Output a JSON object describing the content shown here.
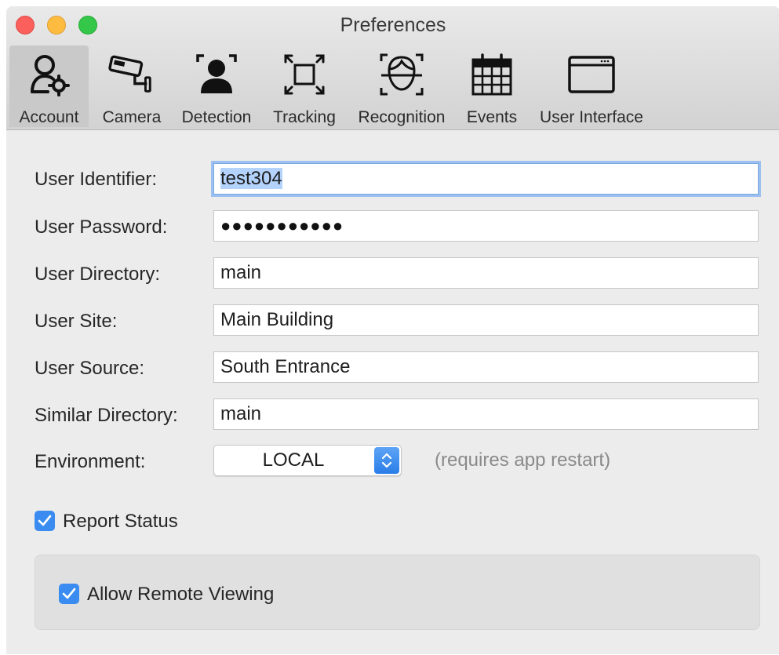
{
  "window": {
    "title": "Preferences"
  },
  "toolbar": {
    "items": [
      {
        "label": "Account",
        "icon": "account-gear-icon",
        "selected": true
      },
      {
        "label": "Camera",
        "icon": "security-camera-icon",
        "selected": false
      },
      {
        "label": "Detection",
        "icon": "person-detection-icon",
        "selected": false
      },
      {
        "label": "Tracking",
        "icon": "tracking-frame-icon",
        "selected": false
      },
      {
        "label": "Recognition",
        "icon": "face-recognition-icon",
        "selected": false
      },
      {
        "label": "Events",
        "icon": "calendar-icon",
        "selected": false
      },
      {
        "label": "User Interface",
        "icon": "window-icon",
        "selected": false
      }
    ]
  },
  "form": {
    "user_identifier": {
      "label": "User Identifier:",
      "value": "test304"
    },
    "user_password": {
      "label": "User Password:",
      "masked_value": "●●●●●●●●●●●"
    },
    "user_directory": {
      "label": "User Directory:",
      "value": "main"
    },
    "user_site": {
      "label": "User Site:",
      "value": "Main Building"
    },
    "user_source": {
      "label": "User Source:",
      "value": "South Entrance"
    },
    "similar_directory": {
      "label": "Similar Directory:",
      "value": "main"
    },
    "environment": {
      "label": "Environment:",
      "value": "LOCAL",
      "hint": "(requires app restart)"
    }
  },
  "options": {
    "report_status": {
      "label": "Report Status",
      "checked": true
    },
    "allow_remote_viewing": {
      "label": "Allow Remote Viewing",
      "checked": true
    }
  },
  "colors": {
    "accent": "#3b8cf0",
    "close": "#fc605c",
    "minimize": "#fdbc40",
    "maximize": "#34c749"
  }
}
